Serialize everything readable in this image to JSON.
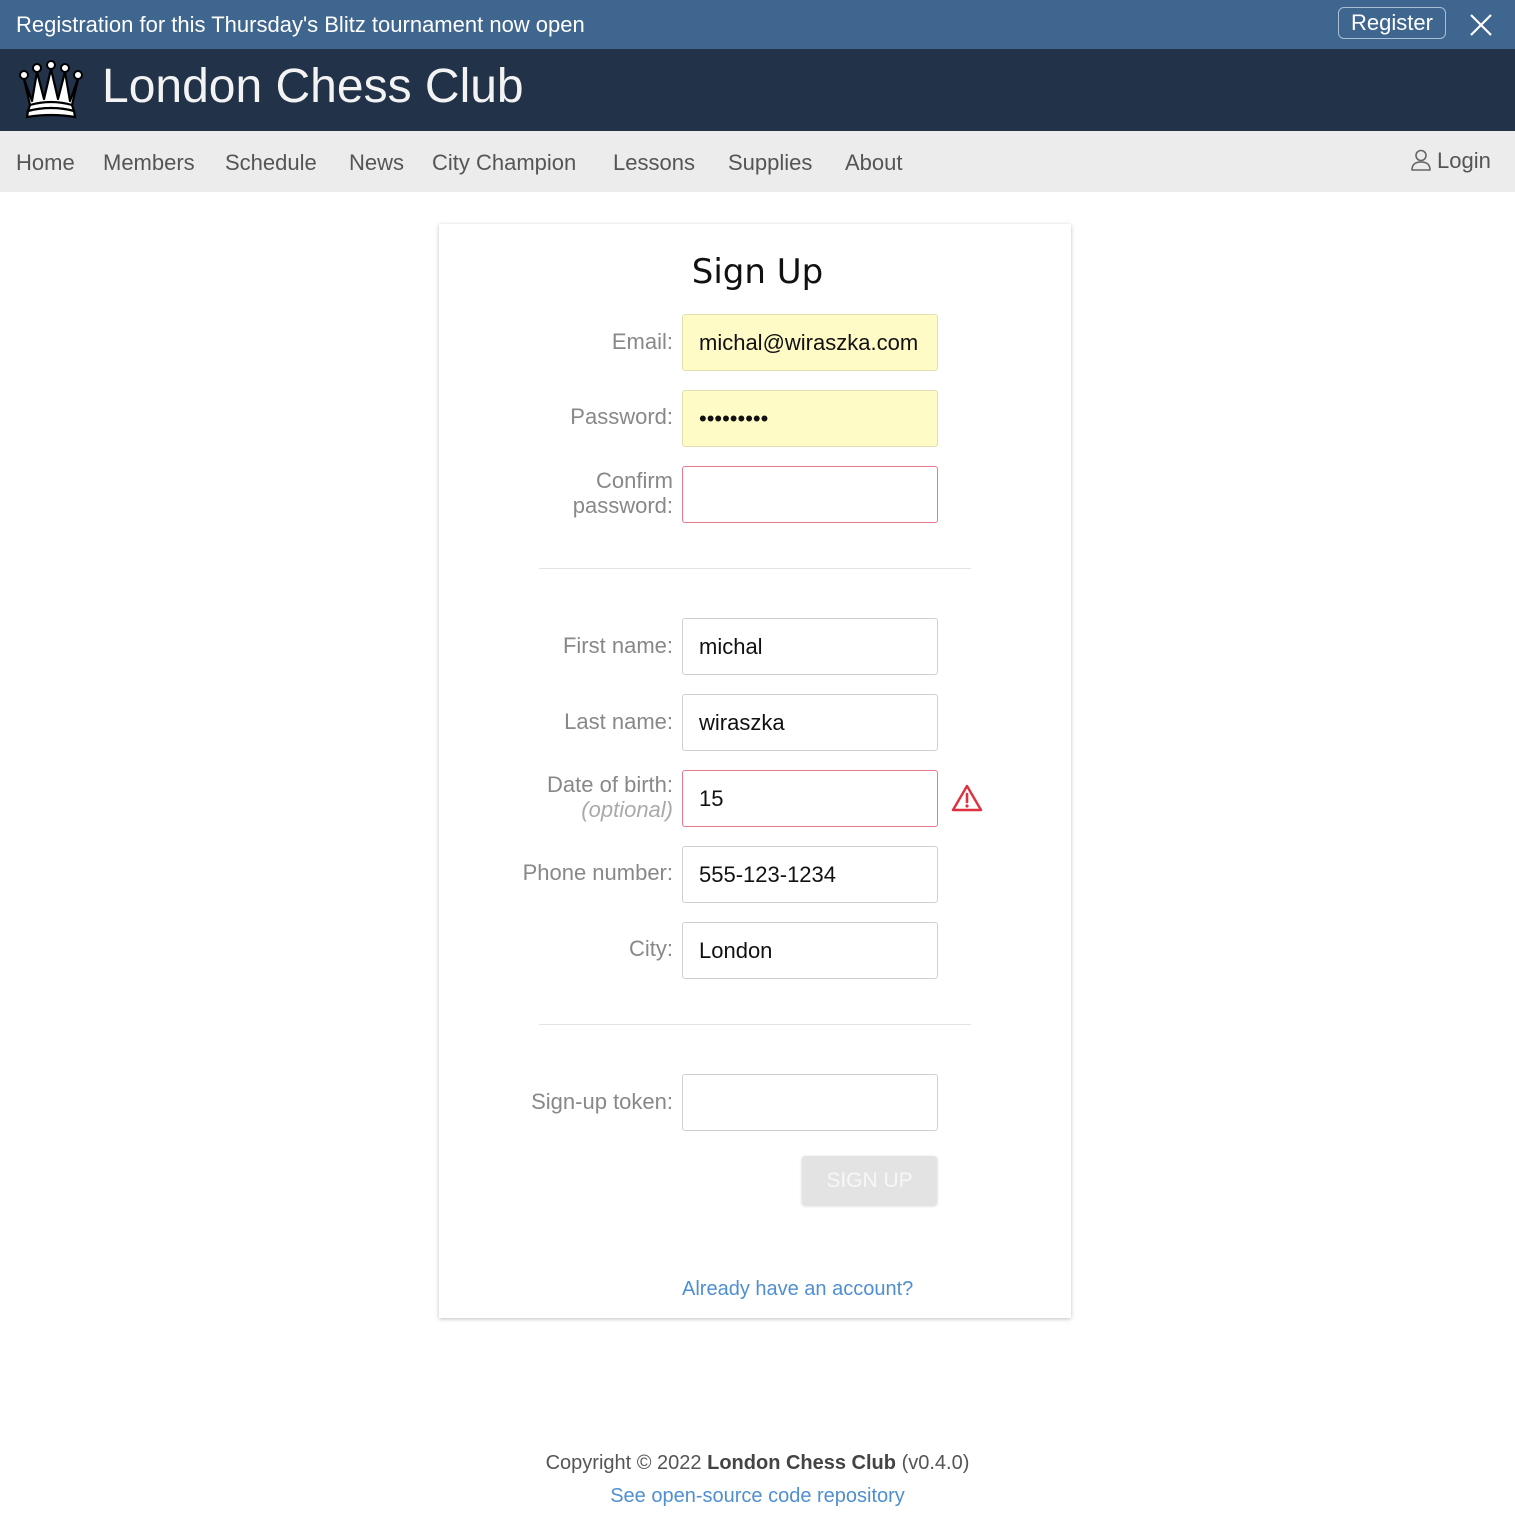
{
  "banner": {
    "text": "Registration for this Thursday's Blitz tournament now open",
    "register_label": "Register",
    "close_icon": "close-icon"
  },
  "header": {
    "logo_icon": "queen-icon",
    "title": "London Chess Club"
  },
  "nav": {
    "items": [
      "Home",
      "Members",
      "Schedule",
      "News",
      "City Champion",
      "Lessons",
      "Supplies",
      "About"
    ],
    "login_label": "Login",
    "login_icon": "user-icon"
  },
  "form": {
    "title": "Sign Up",
    "email": {
      "label": "Email:",
      "value": "michal@wiraszka.com"
    },
    "password": {
      "label": "Password:",
      "value": "•••••••••"
    },
    "confirm_password": {
      "label_line1": "Confirm",
      "label_line2": "password:",
      "value": ""
    },
    "first_name": {
      "label": "First name:",
      "value": "michal"
    },
    "last_name": {
      "label": "Last name:",
      "value": "wiraszka"
    },
    "date_of_birth": {
      "label": "Date of birth:",
      "hint": "(optional)",
      "value": "15",
      "warning_icon": "warning-icon"
    },
    "phone": {
      "label": "Phone number:",
      "value": "555-123-1234"
    },
    "city": {
      "label": "City:",
      "value": "London"
    },
    "token": {
      "label": "Sign-up token:",
      "value": ""
    },
    "submit_label": "SIGN UP",
    "already_link": "Already have an account?"
  },
  "footer": {
    "copyright_prefix": "Copyright © 2022",
    "club_name": "London Chess Club",
    "version": "(v0.4.0)",
    "repo_link": "See open-source code repository"
  },
  "colors": {
    "banner_bg": "#3f668f",
    "header_bg": "#213249",
    "nav_bg": "#ececec",
    "autofill_bg": "#fefbc6",
    "invalid_border": "#e57a8d",
    "link": "#4f8fd1"
  }
}
